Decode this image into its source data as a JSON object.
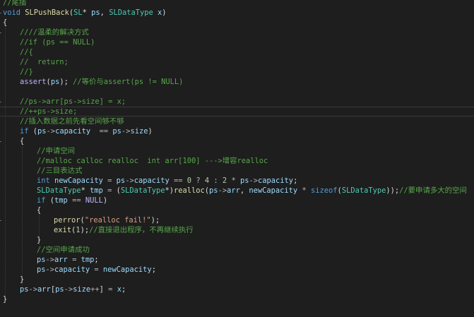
{
  "editor": {
    "name": "code-editor",
    "lines": [
      {
        "indent": 0,
        "tokens": [
          [
            "cm",
            "//尾插"
          ]
        ]
      },
      {
        "indent": 0,
        "tokens": [
          [
            "kw",
            "void"
          ],
          [
            "pl",
            " "
          ],
          [
            "fn",
            "SLPushBack"
          ],
          [
            "pl",
            "("
          ],
          [
            "type",
            "SL"
          ],
          [
            "pl",
            "* "
          ],
          [
            "var",
            "ps"
          ],
          [
            "pl",
            ", "
          ],
          [
            "type",
            "SLDataType"
          ],
          [
            "pl",
            " "
          ],
          [
            "var",
            "x"
          ],
          [
            "pl",
            ")"
          ]
        ]
      },
      {
        "indent": 0,
        "tokens": [
          [
            "pl",
            "{"
          ]
        ]
      },
      {
        "indent": 1,
        "tokens": [
          [
            "cm",
            "////温柔的解决方式"
          ]
        ]
      },
      {
        "indent": 1,
        "tokens": [
          [
            "cm",
            "//if (ps == NULL)"
          ]
        ]
      },
      {
        "indent": 1,
        "tokens": [
          [
            "cm",
            "//{"
          ]
        ]
      },
      {
        "indent": 1,
        "tokens": [
          [
            "cm",
            "//  return;"
          ]
        ]
      },
      {
        "indent": 1,
        "tokens": [
          [
            "cm",
            "//}"
          ]
        ]
      },
      {
        "indent": 1,
        "tokens": [
          [
            "mac",
            "assert"
          ],
          [
            "pl",
            "("
          ],
          [
            "var",
            "ps"
          ],
          [
            "pl",
            "); "
          ],
          [
            "cm",
            "//等价与assert(ps != NULL)"
          ]
        ]
      },
      {
        "indent": 0,
        "tokens": []
      },
      {
        "indent": 1,
        "tokens": [
          [
            "cm",
            "//ps->arr[ps->size] = x;"
          ]
        ]
      },
      {
        "indent": 1,
        "current": true,
        "tokens": [
          [
            "cm",
            "//++ps->size;"
          ]
        ]
      },
      {
        "indent": 1,
        "tokens": [
          [
            "cm",
            "//插入数据之前先看空间够不够"
          ]
        ]
      },
      {
        "indent": 1,
        "tokens": [
          [
            "kw",
            "if"
          ],
          [
            "pl",
            " ("
          ],
          [
            "var",
            "ps"
          ],
          [
            "op",
            "->"
          ],
          [
            "var",
            "capacity"
          ],
          [
            "pl",
            "  "
          ],
          [
            "op",
            "=="
          ],
          [
            "pl",
            " "
          ],
          [
            "var",
            "ps"
          ],
          [
            "op",
            "->"
          ],
          [
            "var",
            "size"
          ],
          [
            "pl",
            ")"
          ]
        ]
      },
      {
        "indent": 1,
        "tokens": [
          [
            "pl",
            "{"
          ]
        ]
      },
      {
        "indent": 2,
        "tokens": [
          [
            "cm",
            "//申请空间"
          ]
        ]
      },
      {
        "indent": 2,
        "tokens": [
          [
            "cm",
            "//malloc calloc realloc  int arr[100] --->增容realloc"
          ]
        ]
      },
      {
        "indent": 2,
        "tokens": [
          [
            "cm",
            "//三目表达式"
          ]
        ]
      },
      {
        "indent": 2,
        "tokens": [
          [
            "kw",
            "int"
          ],
          [
            "pl",
            " "
          ],
          [
            "var",
            "newCapacity"
          ],
          [
            "pl",
            " "
          ],
          [
            "op",
            "="
          ],
          [
            "pl",
            " "
          ],
          [
            "var",
            "ps"
          ],
          [
            "op",
            "->"
          ],
          [
            "var",
            "capacity"
          ],
          [
            "pl",
            " "
          ],
          [
            "op",
            "=="
          ],
          [
            "pl",
            " "
          ],
          [
            "num",
            "0"
          ],
          [
            "pl",
            " "
          ],
          [
            "op",
            "?"
          ],
          [
            "pl",
            " "
          ],
          [
            "num",
            "4"
          ],
          [
            "pl",
            " "
          ],
          [
            "op",
            ":"
          ],
          [
            "pl",
            " "
          ],
          [
            "num",
            "2"
          ],
          [
            "pl",
            " "
          ],
          [
            "op",
            "*"
          ],
          [
            "pl",
            " "
          ],
          [
            "var",
            "ps"
          ],
          [
            "op",
            "->"
          ],
          [
            "var",
            "capacity"
          ],
          [
            "pl",
            ";"
          ]
        ]
      },
      {
        "indent": 2,
        "tokens": [
          [
            "type",
            "SLDataType"
          ],
          [
            "pl",
            "* "
          ],
          [
            "var",
            "tmp"
          ],
          [
            "pl",
            " "
          ],
          [
            "op",
            "="
          ],
          [
            "pl",
            " ("
          ],
          [
            "type",
            "SLDataType"
          ],
          [
            "pl",
            "*)"
          ],
          [
            "fn",
            "realloc"
          ],
          [
            "pl",
            "("
          ],
          [
            "var",
            "ps"
          ],
          [
            "op",
            "->"
          ],
          [
            "var",
            "arr"
          ],
          [
            "pl",
            ", "
          ],
          [
            "var",
            "newCapacity"
          ],
          [
            "pl",
            " "
          ],
          [
            "op",
            "*"
          ],
          [
            "pl",
            " "
          ],
          [
            "kw",
            "sizeof"
          ],
          [
            "pl",
            "("
          ],
          [
            "type",
            "SLDataType"
          ],
          [
            "pl",
            "));"
          ],
          [
            "cm",
            "//要申请多大的空间"
          ]
        ]
      },
      {
        "indent": 2,
        "tokens": [
          [
            "kw",
            "if"
          ],
          [
            "pl",
            " ("
          ],
          [
            "var",
            "tmp"
          ],
          [
            "pl",
            " "
          ],
          [
            "op",
            "=="
          ],
          [
            "pl",
            " "
          ],
          [
            "mac",
            "NULL"
          ],
          [
            "pl",
            ")"
          ]
        ]
      },
      {
        "indent": 2,
        "tokens": [
          [
            "pl",
            "{"
          ]
        ]
      },
      {
        "indent": 3,
        "tokens": [
          [
            "fn",
            "perror"
          ],
          [
            "pl",
            "("
          ],
          [
            "str",
            "\"realloc fail!\""
          ],
          [
            "pl",
            ");"
          ]
        ]
      },
      {
        "indent": 3,
        "tokens": [
          [
            "fn",
            "exit"
          ],
          [
            "pl",
            "("
          ],
          [
            "num",
            "1"
          ],
          [
            "pl",
            ");"
          ],
          [
            "cm",
            "//直接退出程序，不再继续执行"
          ]
        ]
      },
      {
        "indent": 2,
        "tokens": [
          [
            "pl",
            "}"
          ]
        ]
      },
      {
        "indent": 2,
        "tokens": [
          [
            "cm",
            "//空间申请成功"
          ]
        ]
      },
      {
        "indent": 2,
        "tokens": [
          [
            "var",
            "ps"
          ],
          [
            "op",
            "->"
          ],
          [
            "var",
            "arr"
          ],
          [
            "pl",
            " "
          ],
          [
            "op",
            "="
          ],
          [
            "pl",
            " "
          ],
          [
            "var",
            "tmp"
          ],
          [
            "pl",
            ";"
          ]
        ]
      },
      {
        "indent": 2,
        "tokens": [
          [
            "var",
            "ps"
          ],
          [
            "op",
            "->"
          ],
          [
            "var",
            "capacity"
          ],
          [
            "pl",
            " "
          ],
          [
            "op",
            "="
          ],
          [
            "pl",
            " "
          ],
          [
            "var",
            "newCapacity"
          ],
          [
            "pl",
            ";"
          ]
        ]
      },
      {
        "indent": 1,
        "tokens": [
          [
            "pl",
            "}"
          ]
        ]
      },
      {
        "indent": 1,
        "tokens": [
          [
            "var",
            "ps"
          ],
          [
            "op",
            "->"
          ],
          [
            "var",
            "arr"
          ],
          [
            "pl",
            "["
          ],
          [
            "var",
            "ps"
          ],
          [
            "op",
            "->"
          ],
          [
            "var",
            "size"
          ],
          [
            "op",
            "++"
          ],
          [
            "pl",
            "] "
          ],
          [
            "op",
            "="
          ],
          [
            "pl",
            " "
          ],
          [
            "var",
            "x"
          ],
          [
            "pl",
            ";"
          ]
        ]
      },
      {
        "indent": 0,
        "tokens": [
          [
            "pl",
            "}"
          ]
        ]
      }
    ]
  }
}
